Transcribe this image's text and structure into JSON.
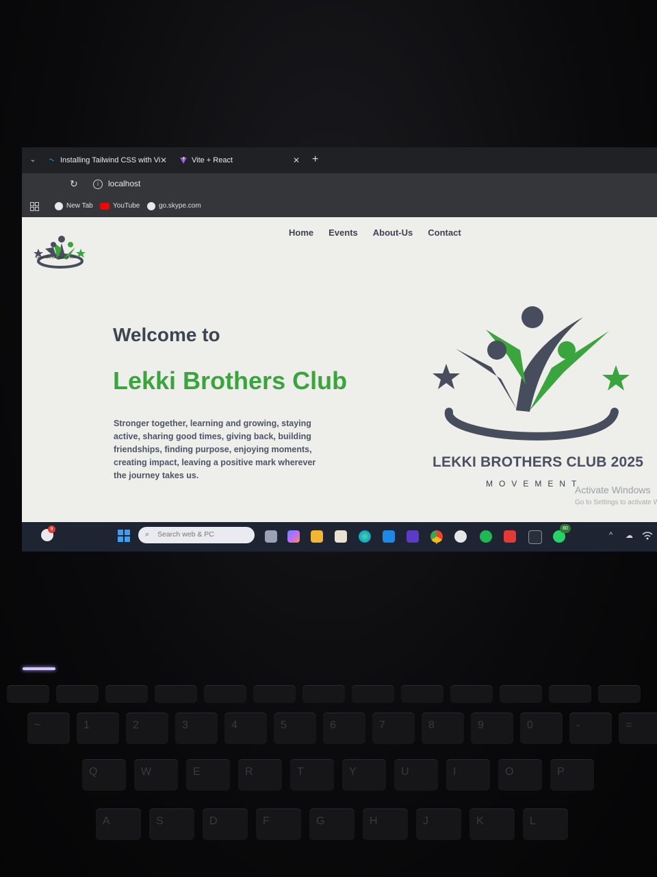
{
  "browser": {
    "tabs": [
      {
        "title": "Installing Tailwind CSS with Vi",
        "close": "✕"
      },
      {
        "title": "Vite + React",
        "close": "✕"
      }
    ],
    "new_tab": "+",
    "menu_glyph": "⌄",
    "address": "localhost",
    "bookmarks": [
      {
        "label": "New Tab"
      },
      {
        "label": "YouTube"
      },
      {
        "label": "go.skype.com"
      }
    ]
  },
  "site": {
    "logo_caption": "LEKKI BROTHERS CLUB 2025",
    "logo_sub": "MOVEMENT",
    "nav": [
      "Home",
      "Events",
      "About-Us",
      "Contact"
    ],
    "welcome": "Welcome to",
    "club_name": "Lekki Brothers Club",
    "tagline": "Stronger together, learning and growing, staying active, sharing good times, giving back, building friendships, finding purpose, enjoying moments, creating impact, leaving a positive mark wherever the journey takes us.",
    "brand_title": "LEKKI BROTHERS CLUB 2025",
    "brand_sub": "MOVEMENT",
    "colors": {
      "green": "#3aa53c",
      "charcoal": "#474d5c",
      "page_bg": "#eeeeea"
    }
  },
  "watermark": {
    "line1": "Activate Windows",
    "line2": "Go to Settings to activate Windows."
  },
  "taskbar": {
    "weather_badge": "9",
    "search_placeholder": "Search web & PC",
    "whatsapp_badge": "80",
    "tray_glyphs": [
      "^",
      "☁",
      "wifi"
    ]
  },
  "keyboard": {
    "row1": [
      "~",
      "1",
      "2",
      "3",
      "4",
      "5",
      "6",
      "7",
      "8",
      "9",
      "0",
      "-",
      "="
    ],
    "row2": [
      "Q",
      "W",
      "E",
      "R",
      "T",
      "Y",
      "U",
      "I",
      "O",
      "P"
    ],
    "row3": [
      "A",
      "S",
      "D",
      "F",
      "G",
      "H",
      "J",
      "K",
      "L"
    ]
  }
}
